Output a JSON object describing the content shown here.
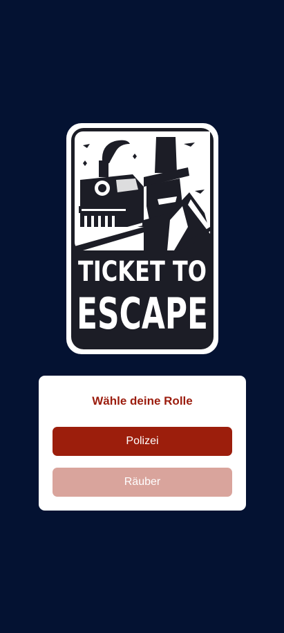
{
  "logo": {
    "line1": "TICKET TO",
    "line2": "ESCAPE"
  },
  "role_card": {
    "title": "Wähle deine Rolle",
    "police_label": "Polizei",
    "robber_label": "Räuber"
  },
  "colors": {
    "background": "#041232",
    "accent": "#9c1e0c",
    "accent_disabled": "#d9a49c",
    "card": "#ffffff"
  }
}
